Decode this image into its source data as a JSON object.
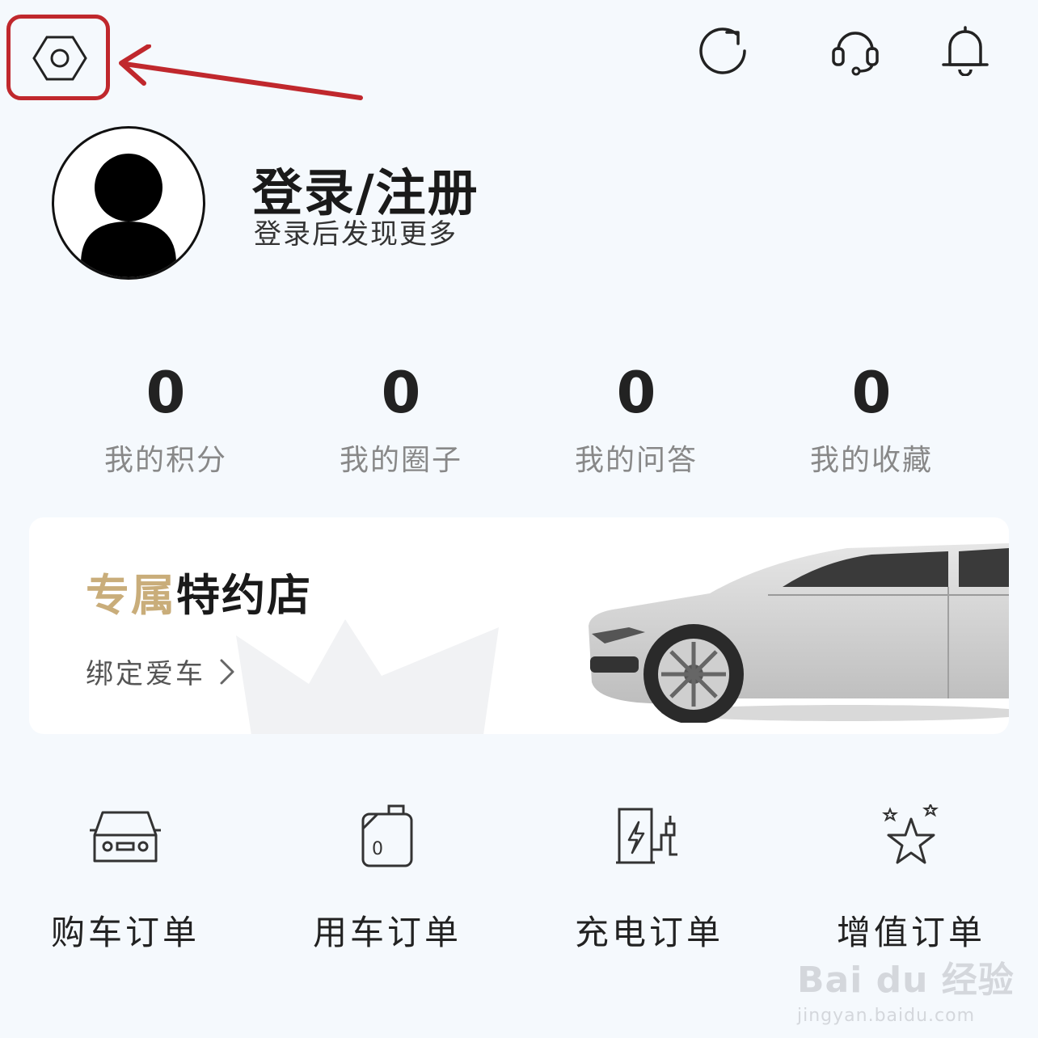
{
  "header": {
    "settings_icon": "hexagon-settings-icon",
    "refresh_icon": "refresh-icon",
    "support_icon": "headset-icon",
    "notification_icon": "bell-icon"
  },
  "annotation": {
    "highlight_color": "#c0282d"
  },
  "profile": {
    "title": "登录/注册",
    "subtitle": "登录后发现更多"
  },
  "stats": [
    {
      "value": "0",
      "label": "我的积分"
    },
    {
      "value": "0",
      "label": "我的圈子"
    },
    {
      "value": "0",
      "label": "我的问答"
    },
    {
      "value": "0",
      "label": "我的收藏"
    }
  ],
  "banner": {
    "title_gold": "专属",
    "title_dark": "特约店",
    "link_label": "绑定爱车",
    "gold_color": "#c9ad7a"
  },
  "orders": [
    {
      "label": "购车订单",
      "icon": "car-icon"
    },
    {
      "label": "用车订单",
      "icon": "fuel-can-icon"
    },
    {
      "label": "充电订单",
      "icon": "charging-station-icon"
    },
    {
      "label": "增值订单",
      "icon": "star-icon"
    }
  ],
  "watermark": {
    "main": "Bai du 经验",
    "sub": "jingyan.baidu.com"
  }
}
